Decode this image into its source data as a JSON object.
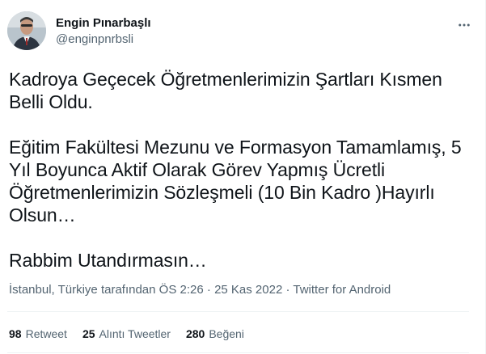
{
  "author": {
    "display_name": "Engin Pınarbaşlı",
    "handle": "@enginpnrbsli"
  },
  "tweet": {
    "text": "Kadroya Geçecek Öğretmenlerimizin Şartları Kısmen\nBelli Oldu.\n\nEğitim Fakültesi Mezunu ve Formasyon Tamamlamış, 5\nYıl Boyunca Aktif Olarak Görev Yapmış Ücretli\nÖğretmenlerimizin Sözleşmeli (10 Bin Kadro )Hayırlı\nOlsun…\n\nRabbim Utandırmasın…"
  },
  "meta": {
    "location": "İstanbul, Türkiye tarafından",
    "time": "ÖS 2:26",
    "separator": "·",
    "date": "25 Kas 2022",
    "source": "Twitter for Android"
  },
  "stats": {
    "retweets": {
      "count": "98",
      "label": "Retweet"
    },
    "quotes": {
      "count": "25",
      "label": "Alıntı Tweetler"
    },
    "likes": {
      "count": "280",
      "label": "Beğeni"
    }
  },
  "icons": {
    "more": "more-horizontal-icon"
  },
  "colors": {
    "text": "#0f1419",
    "secondary": "#536471",
    "divider": "#eff3f4"
  }
}
